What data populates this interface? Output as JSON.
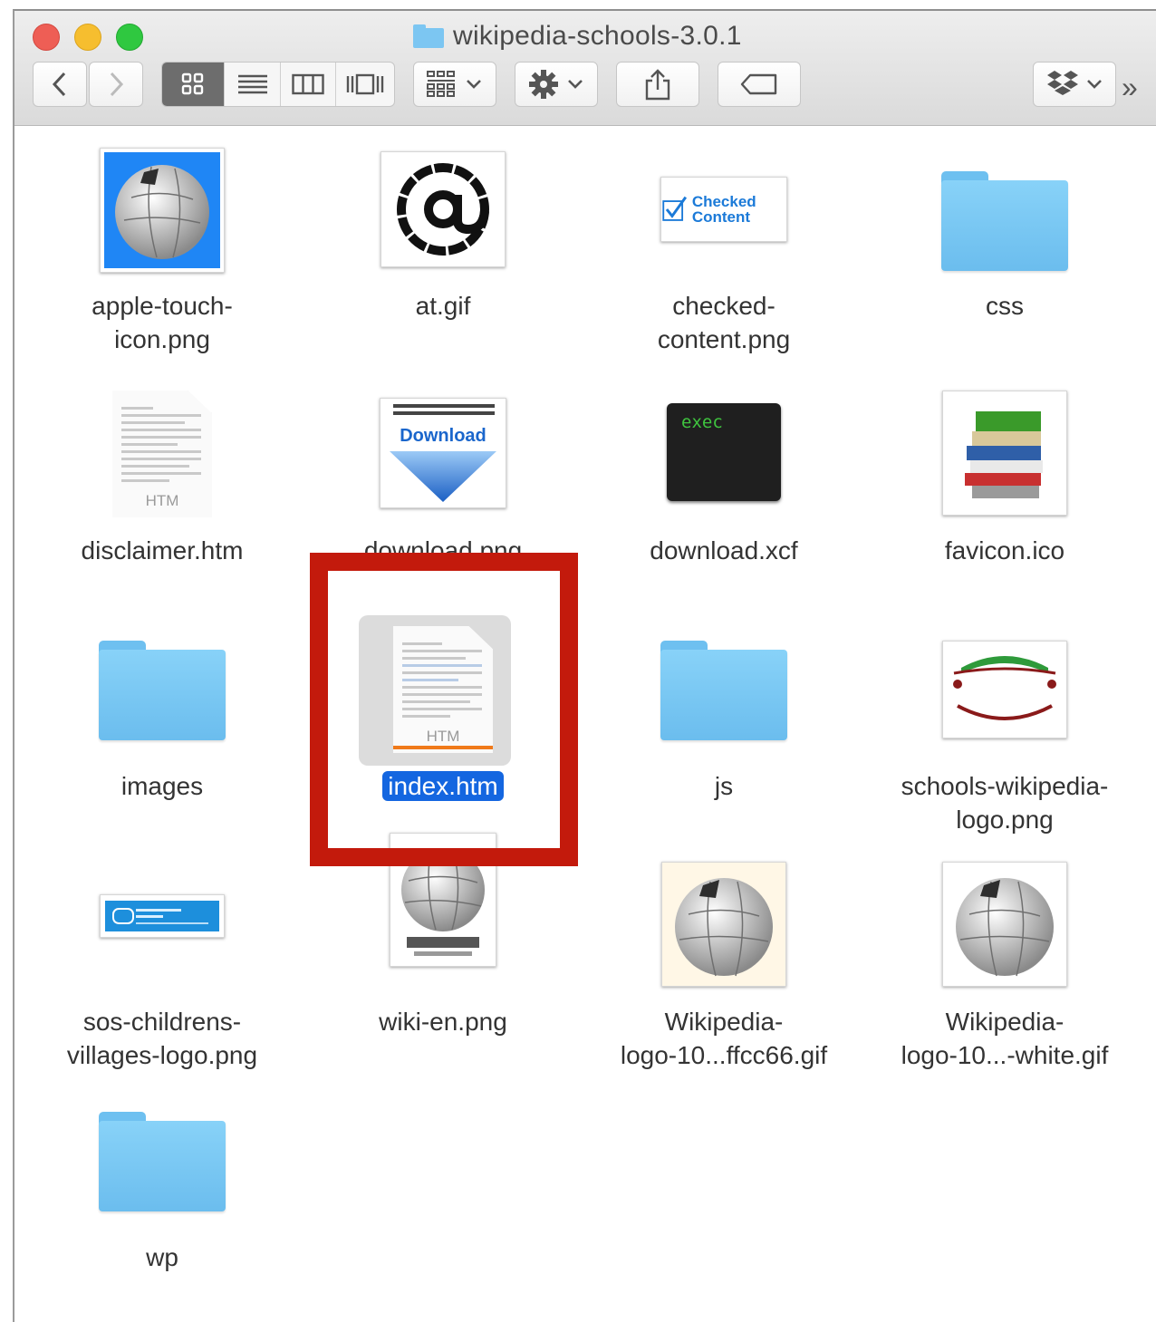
{
  "window": {
    "title": "wikipedia-schools-3.0.1",
    "toolbar": {
      "back_icon": "chevron-left-icon",
      "forward_icon": "chevron-right-icon",
      "view_modes": [
        "icon-view-icon",
        "list-view-icon",
        "column-view-icon",
        "cover-flow-icon"
      ],
      "arrange_icon": "arrange-icon",
      "action_icon": "gear-icon",
      "share_icon": "share-icon",
      "tag_icon": "tag-icon",
      "dropbox_icon": "dropbox-icon",
      "overflow_label": "»"
    }
  },
  "files": [
    {
      "name": "apple-touch-icon.png",
      "line1": "apple-touch-",
      "line2": "icon.png",
      "kind": "image",
      "icon": "wikipedia-globe-blue-icon"
    },
    {
      "name": "at.gif",
      "line1": "at.gif",
      "line2": "",
      "kind": "image",
      "icon": "at-sign-icon"
    },
    {
      "name": "checked-content.png",
      "line1": "checked-",
      "line2": "content.png",
      "kind": "image",
      "icon": "checked-content-icon",
      "thumb_text": "Checked Content"
    },
    {
      "name": "css",
      "line1": "css",
      "line2": "",
      "kind": "folder",
      "icon": "folder-icon"
    },
    {
      "name": "disclaimer.htm",
      "line1": "disclaimer.htm",
      "line2": "",
      "kind": "document",
      "icon": "htm-document-icon",
      "thumb_text": "HTM"
    },
    {
      "name": "download.png",
      "line1": "download.png",
      "line2": "",
      "kind": "image",
      "icon": "download-arrow-icon",
      "thumb_text": "Download"
    },
    {
      "name": "download.xcf",
      "line1": "download.xcf",
      "line2": "",
      "kind": "image",
      "icon": "exec-terminal-icon",
      "thumb_text": "exec"
    },
    {
      "name": "favicon.ico",
      "line1": "favicon.ico",
      "line2": "",
      "kind": "image",
      "icon": "books-stack-icon"
    },
    {
      "name": "images",
      "line1": "images",
      "line2": "",
      "kind": "folder",
      "icon": "folder-icon"
    },
    {
      "name": "index.htm",
      "line1": "index.htm",
      "line2": "",
      "kind": "document",
      "icon": "htm-document-icon",
      "thumb_text": "HTM",
      "selected": true
    },
    {
      "name": "js",
      "line1": "js",
      "line2": "",
      "kind": "folder",
      "icon": "folder-icon"
    },
    {
      "name": "schools-wikipedia-logo.png",
      "line1": "schools-wikipedia-",
      "line2": "logo.png",
      "kind": "image",
      "icon": "wikipedia-for-schools-logo-icon"
    },
    {
      "name": "sos-childrens-villages-logo.png",
      "line1": "sos-childrens-",
      "line2": "villages-logo.png",
      "kind": "image",
      "icon": "sos-logo-icon"
    },
    {
      "name": "wiki-en.png",
      "line1": "wiki-en.png",
      "line2": "",
      "kind": "image",
      "icon": "wikipedia-globe-icon"
    },
    {
      "name": "Wikipedia-logo-10...ffcc66.gif",
      "line1": "Wikipedia-",
      "line2": "logo-10...ffcc66.gif",
      "kind": "image",
      "icon": "wikipedia-globe-icon"
    },
    {
      "name": "Wikipedia-logo-10...-white.gif",
      "line1": "Wikipedia-",
      "line2": "logo-10...-white.gif",
      "kind": "image",
      "icon": "wikipedia-globe-icon"
    },
    {
      "name": "wp",
      "line1": "wp",
      "line2": "",
      "kind": "folder",
      "icon": "folder-icon"
    }
  ],
  "colors": {
    "selection": "#1466e0",
    "highlight_box": "#c31a0c",
    "folder": "#7cc6f2"
  }
}
